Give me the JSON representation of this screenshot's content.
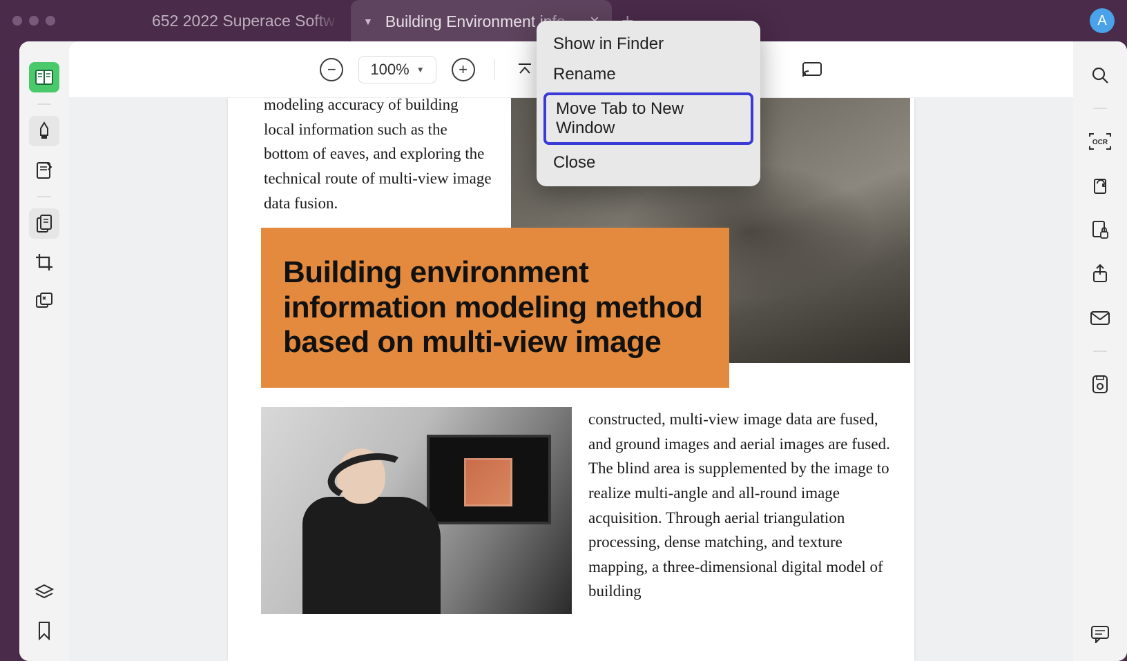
{
  "titlebar": {
    "inactive_tab": "652  2022  Superace Softw",
    "active_tab": "Building Environment info",
    "avatar_initial": "A"
  },
  "toolbar": {
    "zoom": "100%"
  },
  "context_menu": {
    "items": [
      "Show in Finder",
      "Rename",
      "Move Tab to New Window",
      "Close"
    ]
  },
  "document": {
    "top_paragraph": "modeling accuracy of building local information such as the bottom of eaves, and exploring the technical route of multi-view image data fusion.",
    "heading": "Building environment information modeling method based on multi-view image",
    "bottom_paragraph": "constructed, multi-view image data are fused, and ground images and aerial images are fused. The blind area is supplemented by the image to realize multi-angle and all-round image acquisition. Through aerial triangulation processing, dense matching, and texture mapping, a three-dimensional digital model of building"
  }
}
